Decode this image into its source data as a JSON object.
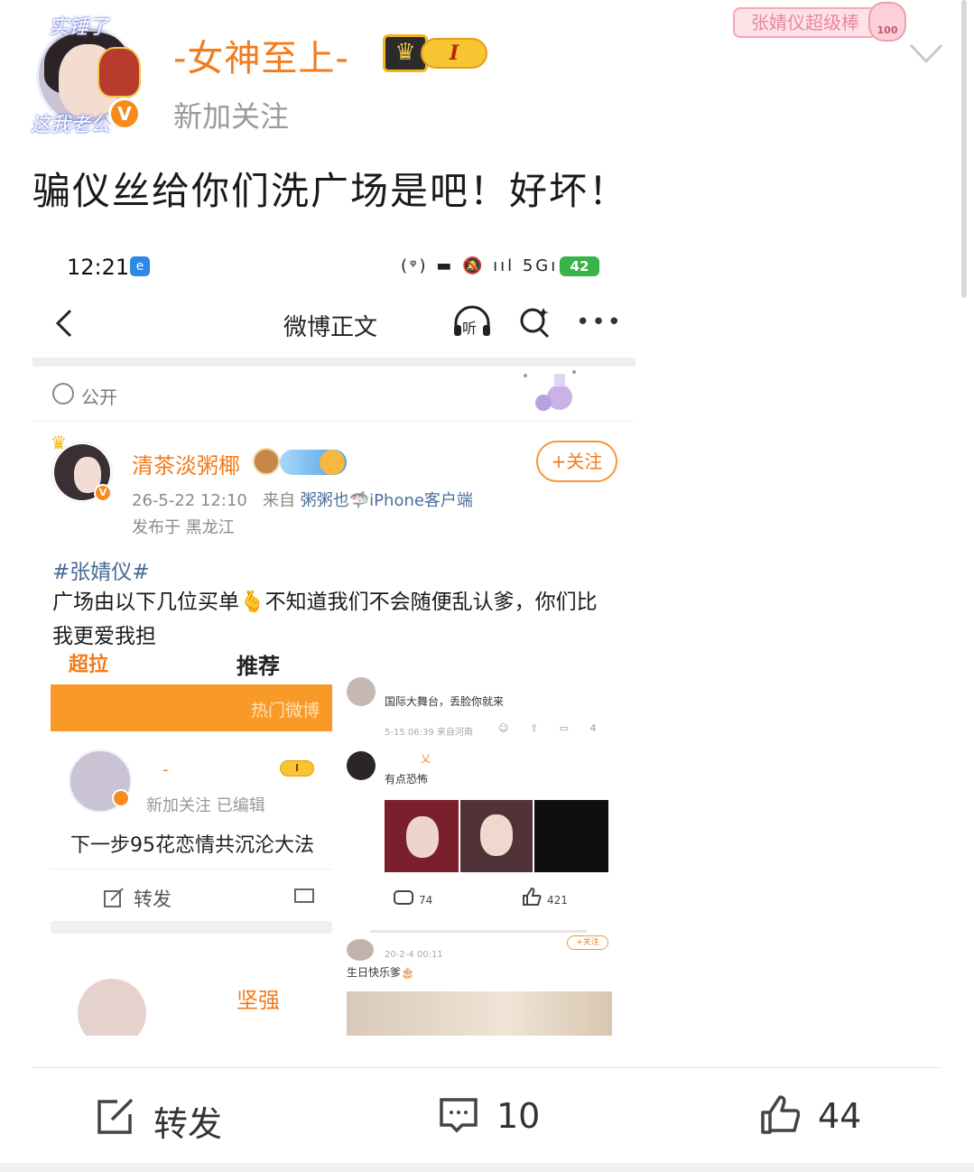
{
  "post": {
    "username": "-女神至上-",
    "level_badge": "I",
    "subtitle": "新加关注",
    "super_tag": "张婧仪超级棒",
    "super_tag_score": "100",
    "avatar_top_text": "实锤了",
    "avatar_bottom_text": "这我老公",
    "verified_mark": "V",
    "text": "骗仪丝给你们洗广场是吧！好坏！"
  },
  "screenshot": {
    "status": {
      "time": "12:21",
      "app_icon": "e",
      "signal_text": "(ᵠ) ▬ 🔕 ııl 5Gııl",
      "battery": "42"
    },
    "nav": {
      "title": "微博正文",
      "listen_label": "听"
    },
    "visibility": "公开",
    "inner_post": {
      "author": "清茶淡粥椰",
      "follow_button": "+关注",
      "meta_time": "26-5-22 12:10",
      "meta_from_prefix": "来自",
      "meta_source": "粥粥也🦈iPhone客户端",
      "location": "发布于 黑龙江",
      "hashtag": "#张婧仪#",
      "body": "广场由以下几位买单🫰不知道我们不会随便乱认爹，你们比我更爱我担"
    },
    "collage": {
      "left": {
        "cut_top_left": "超拉",
        "cut_top_right": "推荐",
        "orange_bar_text": "热门微博",
        "name_dash": "-",
        "level_pill": "I",
        "meta": "新加关注  已编辑",
        "text": "下一步95花恋情共沉沦大法",
        "repost_label": "转发",
        "next_name": "坚强"
      },
      "right": {
        "comment1": "国际大舞台，丢脸你就来",
        "meta1": "5-15 06:39 来自河南",
        "actions1": "☺ ⇪ ▭ 4",
        "name2": "乂",
        "comment2": "有点恐怖",
        "comment_count": "74",
        "like_count": "421",
        "meta3": "20-2-4 00:11",
        "follow3": "+关注",
        "comment3": "生日快乐爹🎂"
      }
    }
  },
  "actions": {
    "repost_label": "转发",
    "comment_count": "10",
    "like_count": "44"
  }
}
